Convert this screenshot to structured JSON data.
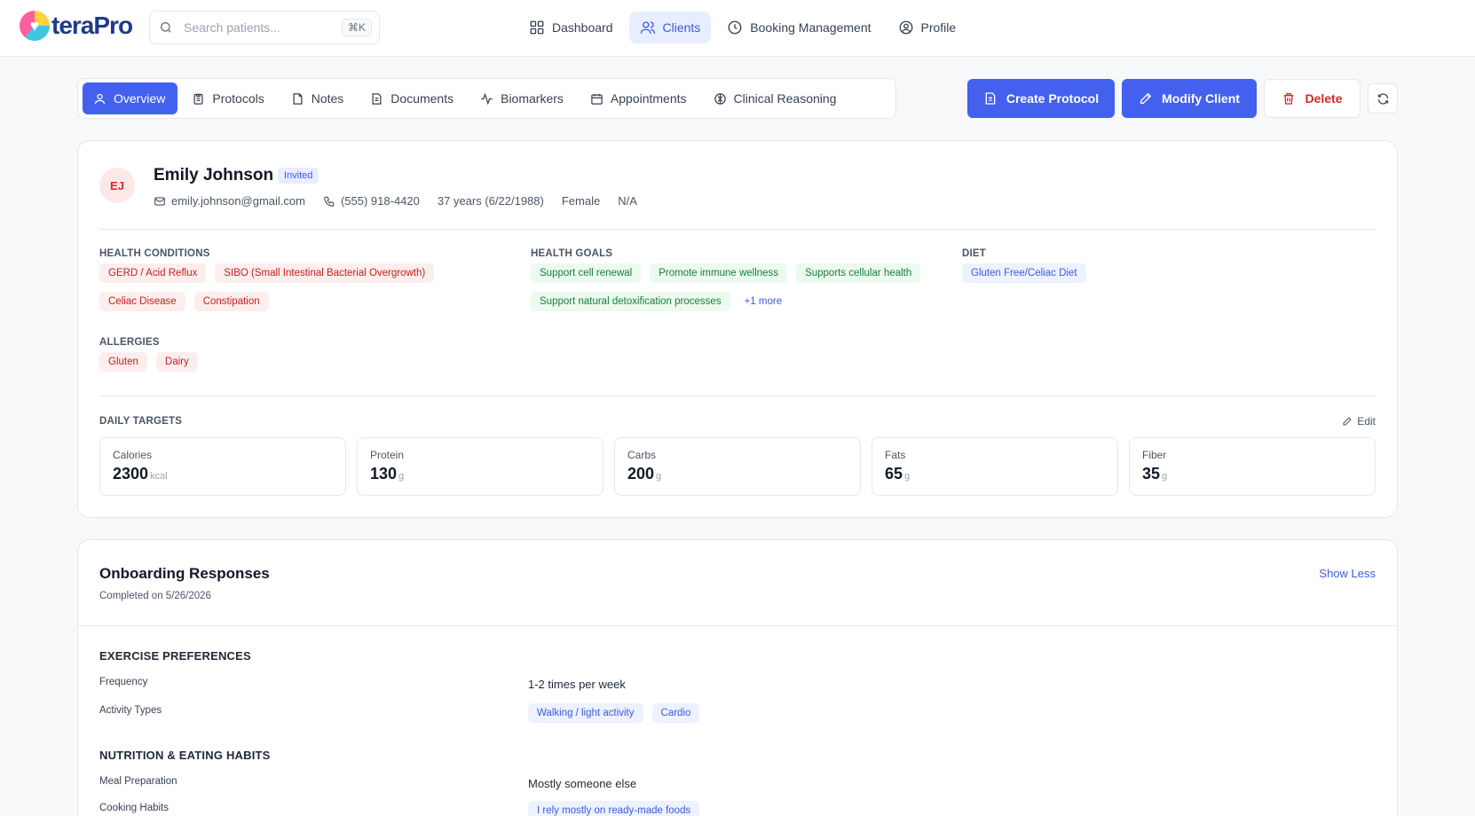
{
  "app": {
    "brand": "teraPro"
  },
  "search": {
    "placeholder": "Search patients...",
    "shortcut": "⌘K"
  },
  "nav": {
    "items": [
      {
        "label": "Dashboard",
        "icon": "dashboard-grid-icon"
      },
      {
        "label": "Clients",
        "icon": "users-icon",
        "active": true
      },
      {
        "label": "Booking Management",
        "icon": "clock-icon"
      },
      {
        "label": "Profile",
        "icon": "user-circle-icon"
      }
    ]
  },
  "tabs": [
    {
      "label": "Overview",
      "icon": "user-icon",
      "active": true
    },
    {
      "label": "Protocols",
      "icon": "clipboard-icon"
    },
    {
      "label": "Notes",
      "icon": "note-icon"
    },
    {
      "label": "Documents",
      "icon": "document-icon"
    },
    {
      "label": "Biomarkers",
      "icon": "activity-icon"
    },
    {
      "label": "Appointments",
      "icon": "calendar-icon"
    },
    {
      "label": "Clinical Reasoning",
      "icon": "brain-icon"
    }
  ],
  "actions": {
    "create_protocol": "Create Protocol",
    "modify_client": "Modify Client",
    "delete": "Delete"
  },
  "client": {
    "initials": "EJ",
    "name": "Emily Johnson",
    "status": "Invited",
    "email": "emily.johnson@gmail.com",
    "phone": "(555) 918-4420",
    "age": "37 years (6/22/1988)",
    "gender": "Female",
    "extra": "N/A"
  },
  "health_conditions": {
    "label": "HEALTH CONDITIONS",
    "items": [
      "GERD / Acid Reflux",
      "SIBO (Small Intestinal Bacterial Overgrowth)",
      "Celiac Disease",
      "Constipation"
    ]
  },
  "health_goals": {
    "label": "HEALTH GOALS",
    "items": [
      "Support cell renewal",
      "Promote immune wellness",
      "Supports cellular health",
      "Support natural detoxification processes"
    ],
    "more": "+1 more"
  },
  "diet": {
    "label": "DIET",
    "items": [
      "Gluten Free/Celiac Diet"
    ]
  },
  "allergies": {
    "label": "ALLERGIES",
    "items": [
      "Gluten",
      "Dairy"
    ]
  },
  "daily_targets": {
    "label": "DAILY TARGETS",
    "edit": "Edit",
    "items": [
      {
        "label": "Calories",
        "value": "2300",
        "unit": "kcal"
      },
      {
        "label": "Protein",
        "value": "130",
        "unit": "g"
      },
      {
        "label": "Carbs",
        "value": "200",
        "unit": "g"
      },
      {
        "label": "Fats",
        "value": "65",
        "unit": "g"
      },
      {
        "label": "Fiber",
        "value": "35",
        "unit": "g"
      }
    ]
  },
  "onboarding": {
    "title": "Onboarding Responses",
    "completed": "Completed on 5/26/2026",
    "toggle": "Show Less",
    "sections": {
      "exercise": {
        "heading": "EXERCISE PREFERENCES",
        "frequency_q": "Frequency",
        "frequency_a": "1-2 times per week",
        "activity_q": "Activity Types",
        "activity_a": [
          "Walking / light activity",
          "Cardio"
        ]
      },
      "nutrition": {
        "heading": "NUTRITION & EATING HABITS",
        "meal_q": "Meal Preparation",
        "meal_a": "Mostly someone else",
        "cooking_q": "Cooking Habits",
        "cooking_a": [
          "I rely mostly on ready-made foods"
        ]
      }
    }
  },
  "colors": {
    "accent": "#4361ee",
    "danger": "#dc2626",
    "condition": "#c81e1e",
    "goal": "#15803d"
  }
}
